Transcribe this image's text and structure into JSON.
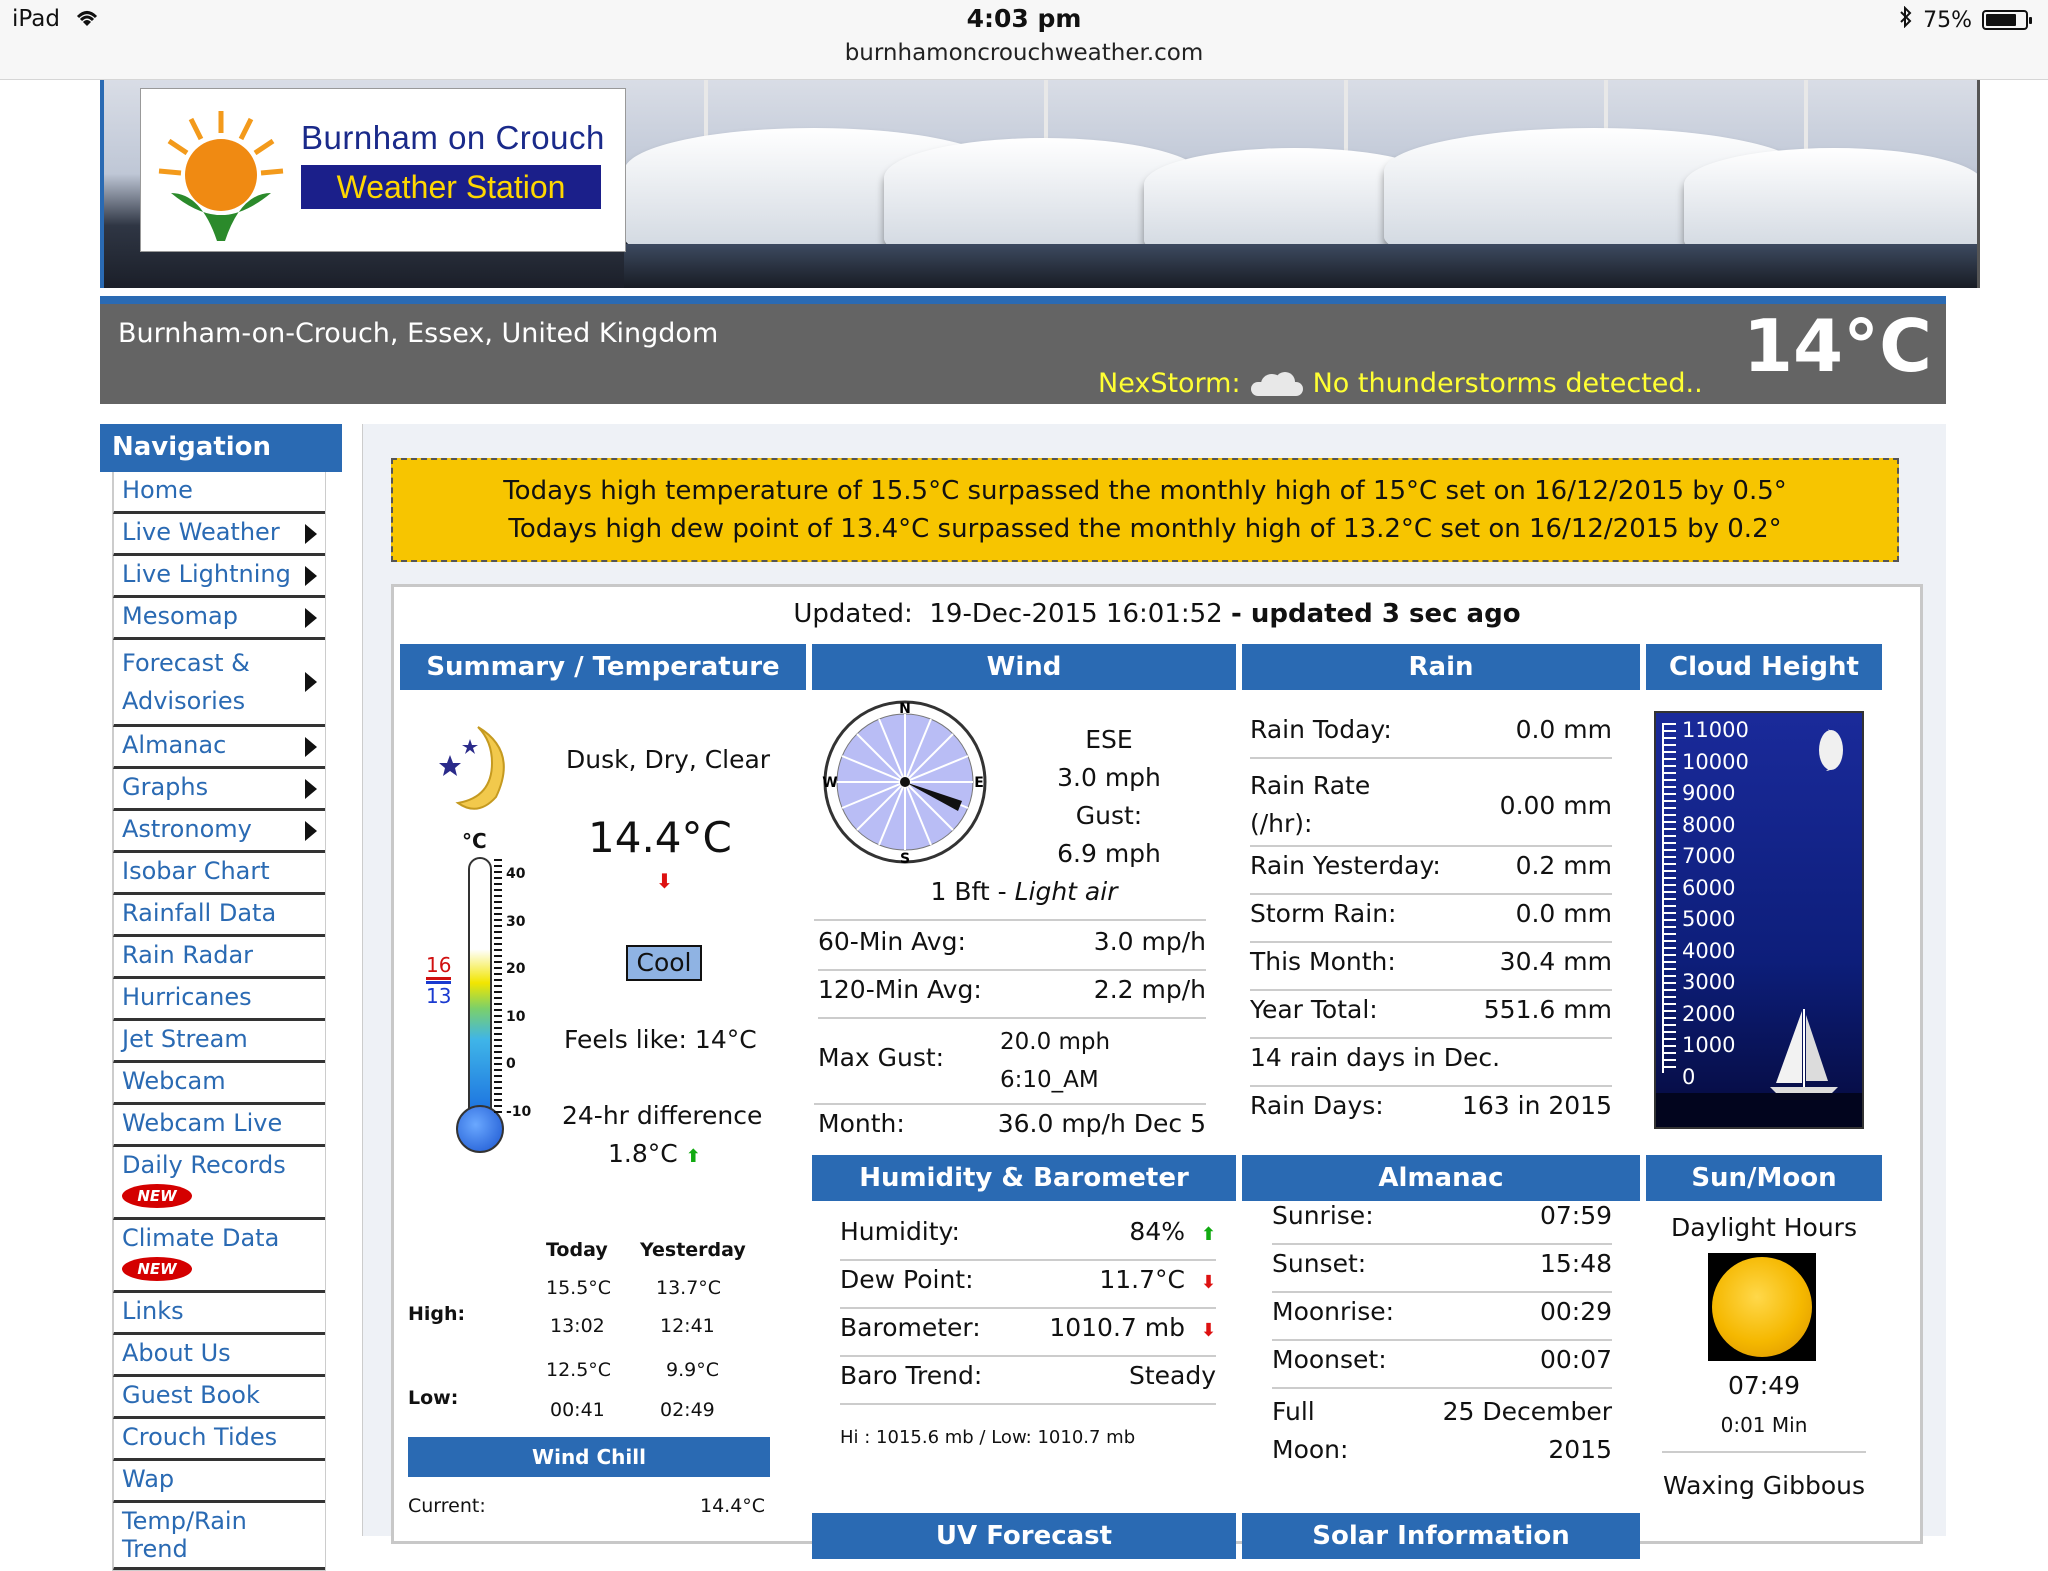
{
  "status_bar": {
    "device": "iPad",
    "time": "4:03 pm",
    "url": "burnhamoncrouchweather.com",
    "battery": "75%"
  },
  "banner": {
    "logo_line1": "Burnham on Crouch",
    "logo_line2": "Weather Station"
  },
  "header": {
    "location": "Burnham-on-Crouch, Essex, United Kingdom",
    "current_temp": "14°C",
    "nexstorm_label": "NexStorm:",
    "nexstorm_status": "No thunderstorms detected.."
  },
  "nav": {
    "title": "Navigation",
    "items": [
      {
        "label": "Home",
        "has_submenu": false
      },
      {
        "label": "Live Weather",
        "has_submenu": true
      },
      {
        "label": "Live Lightning",
        "has_submenu": true
      },
      {
        "label": "Mesomap",
        "has_submenu": true
      },
      {
        "label": "Forecast & Advisories",
        "has_submenu": true
      },
      {
        "label": "Almanac",
        "has_submenu": true
      },
      {
        "label": "Graphs",
        "has_submenu": true
      },
      {
        "label": "Astronomy",
        "has_submenu": true
      },
      {
        "label": "Isobar Chart",
        "has_submenu": false
      },
      {
        "label": "Rainfall Data",
        "has_submenu": false
      },
      {
        "label": "Rain Radar",
        "has_submenu": false
      },
      {
        "label": "Hurricanes",
        "has_submenu": false
      },
      {
        "label": "Jet Stream",
        "has_submenu": false
      },
      {
        "label": "Webcam",
        "has_submenu": false
      },
      {
        "label": "Webcam Live",
        "has_submenu": false
      },
      {
        "label": "Daily Records",
        "has_submenu": false,
        "badge": "NEW"
      },
      {
        "label": "Climate Data",
        "has_submenu": false,
        "badge": "NEW"
      },
      {
        "label": "Links",
        "has_submenu": false
      },
      {
        "label": "About Us",
        "has_submenu": false
      },
      {
        "label": "Guest Book",
        "has_submenu": false
      },
      {
        "label": "Crouch Tides",
        "has_submenu": false
      },
      {
        "label": "Wap",
        "has_submenu": false
      },
      {
        "label": "Temp/Rain Trend",
        "has_submenu": false
      }
    ]
  },
  "alert": {
    "line1": "Todays high temperature of 15.5°C surpassed the monthly high of 15°C set on 16/12/2015 by 0.5°",
    "line2": "Todays high dew point of 13.4°C surpassed the monthly high of 13.2°C set on 16/12/2015 by 0.2°"
  },
  "updated": {
    "label": "Updated:",
    "timestamp": "19-Dec-2015 16:01:52",
    "ago": "- updated 3 sec ago"
  },
  "summary": {
    "heading": "Summary / Temperature",
    "condition": "Dusk, Dry, Clear",
    "temp": "14.4°C",
    "comfort": "Cool",
    "feels_like": "Feels like: 14°C",
    "diff_label": "24-hr difference",
    "diff_value": "1.8°C",
    "thermo_unit": "°C",
    "thermo_high": "16",
    "thermo_low": "13",
    "thermo_scale": [
      "40",
      "30",
      "20",
      "10",
      "0",
      "-10"
    ],
    "table_cols": [
      "Today",
      "Yesterday"
    ],
    "high_label": "High:",
    "high_today": "15.5°C",
    "high_today_time": "13:02",
    "high_yest": "13.7°C",
    "high_yest_time": "12:41",
    "low_label": "Low:",
    "low_today": "12.5°C",
    "low_today_time": "00:41",
    "low_yest": "9.9°C",
    "low_yest_time": "02:49",
    "wind_chill_heading": "Wind Chill",
    "current_label": "Current:",
    "current_value": "14.4°C"
  },
  "wind": {
    "heading": "Wind",
    "direction": "ESE",
    "speed": "3.0 mph",
    "gust_label": "Gust:",
    "gust": "6.9 mph",
    "beaufort": "1 Bft - ",
    "beaufort_desc": "Light air",
    "compass": {
      "n": "N",
      "e": "E",
      "s": "S",
      "w": "W"
    },
    "rows": [
      {
        "label": "60-Min Avg:",
        "value": "3.0 mp/h"
      },
      {
        "label": "120-Min Avg:",
        "value": "2.2 mp/h"
      }
    ],
    "max_gust_label": "Max Gust:",
    "max_gust_value": "20.0 mph",
    "max_gust_time": "6:10_AM",
    "month_label": "Month:",
    "month_value": "36.0 mp/h Dec 5"
  },
  "rain": {
    "heading": "Rain",
    "today_label": "Rain Today:",
    "today": "0.0 mm",
    "rate_label1": "Rain Rate",
    "rate_label2": "(/hr):",
    "rate": "0.00 mm",
    "yesterday_label": "Rain Yesterday:",
    "yesterday": "0.2 mm",
    "storm_label": "Storm Rain:",
    "storm": "0.0 mm",
    "month_label": "This Month:",
    "month": "30.4 mm",
    "year_label": "Year Total:",
    "year": "551.6 mm",
    "days_dec": "14 rain days in Dec.",
    "days_label": "Rain Days:",
    "days": "163 in 2015"
  },
  "cloud": {
    "heading": "Cloud Height",
    "scale": [
      "11000",
      "10000",
      "9000",
      "8000",
      "7000",
      "6000",
      "5000",
      "4000",
      "3000",
      "2000",
      "1000",
      "0"
    ]
  },
  "humidity": {
    "heading": "Humidity & Barometer",
    "humidity_label": "Humidity:",
    "humidity": "84%",
    "dew_label": "Dew Point:",
    "dew": "11.7°C",
    "baro_label": "Barometer:",
    "baro": "1010.7 mb",
    "trend_label": "Baro Trend:",
    "trend": "Steady",
    "hilo": "Hi : 1015.6 mb / Low: 1010.7 mb"
  },
  "almanac": {
    "heading": "Almanac",
    "sunrise_label": "Sunrise:",
    "sunrise": "07:59",
    "sunset_label": "Sunset:",
    "sunset": "15:48",
    "moonrise_label": "Moonrise:",
    "moonrise": "00:29",
    "moonset_label": "Moonset:",
    "moonset": "00:07",
    "fullmoon_label1": "Full",
    "fullmoon_label2": "Moon:",
    "fullmoon_date1": "25 December",
    "fullmoon_date2": "2015"
  },
  "sunmoon": {
    "heading": "Sun/Moon",
    "daylight_label": "Daylight Hours",
    "daylight": "07:49",
    "daylight_change": "0:01 Min",
    "moon_phase": "Waxing Gibbous"
  },
  "partial_headings": {
    "uv": "UV Forecast",
    "solar": "Solar Information"
  },
  "colors": {
    "accent_blue": "#2a6ab3",
    "alert_yellow": "#f7c500",
    "nexstorm_yellow": "#ffff33",
    "header_gray": "#646464"
  }
}
